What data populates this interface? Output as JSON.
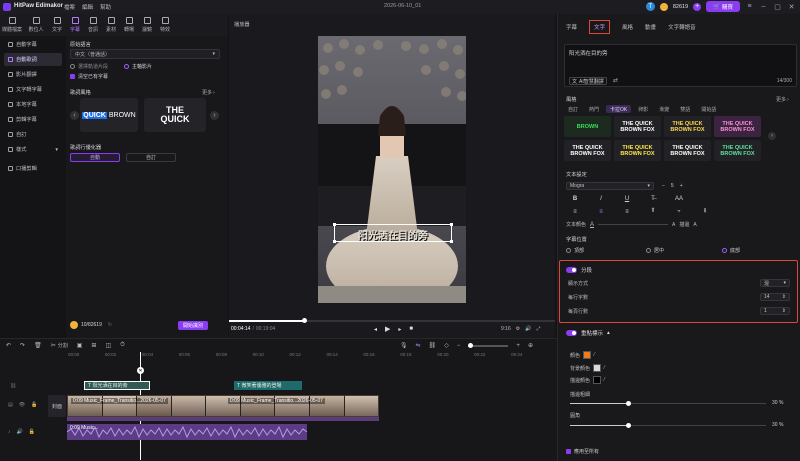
{
  "titlebar": {
    "app_name": "HitPaw Edimakor",
    "menu": [
      "檔案",
      "編輯",
      "幫助"
    ],
    "doc_title": "2026-06-10_01",
    "avatar_letter": "T",
    "credits": "82619",
    "buy_label": "購買"
  },
  "toolbar": [
    {
      "label": "媒體檔案",
      "icon": "media-icon"
    },
    {
      "label": "數位人",
      "icon": "avatar-icon"
    },
    {
      "label": "文字",
      "icon": "text-icon"
    },
    {
      "label": "字幕",
      "icon": "subtitle-icon",
      "active": true
    },
    {
      "label": "音訊",
      "icon": "audio-icon"
    },
    {
      "label": "素材",
      "icon": "stock-icon"
    },
    {
      "label": "轉場",
      "icon": "transition-icon"
    },
    {
      "label": "濾鏡",
      "icon": "filter-icon"
    },
    {
      "label": "特效",
      "icon": "effects-icon"
    }
  ],
  "leftnav": [
    {
      "label": "自動字幕"
    },
    {
      "label": "自動歌詞",
      "active": true
    },
    {
      "label": "影片翻譯"
    },
    {
      "label": "文字轉字幕"
    },
    {
      "label": "本地字幕"
    },
    {
      "label": "剪輯字幕"
    },
    {
      "label": "自訂"
    },
    {
      "label": "樣式"
    },
    {
      "label": "口播剪輯"
    }
  ],
  "subpanel": {
    "lang_label": "原始語言",
    "lang_value": "中文（普通話）",
    "radio1": "選擇軌道片段",
    "radio2": "主軸影片",
    "checkbox": "清空已有字幕",
    "style_label": "歌詞風格",
    "more": "更多",
    "style1_a": "QUICK",
    "style1_b": "BROWN",
    "style2_a": "THE",
    "style2_b": "QUICK",
    "optimizer_label": "歌詞行優化器",
    "seg_auto": "自動",
    "seg_custom": "自訂",
    "cost": "10/82619",
    "start_label": "開始識別"
  },
  "preview": {
    "header": "播放器",
    "caption": "阳光洒在目的旁",
    "time_current": "00:04:14",
    "time_total": "00:19:04",
    "aspect": "9:16",
    "progress": 0.23
  },
  "timeline": {
    "split_label": "分割",
    "ruler": [
      "00:00",
      "00:02",
      "00:04",
      "00:06",
      "00:08",
      "00:10",
      "00:12",
      "00:14",
      "00:16",
      "00:18",
      "00:20",
      "00:22",
      "00:24"
    ],
    "sub_clip1": "阳光洒在目的旁",
    "sub_clip2": "微笑著優雅的登場",
    "video_clip": "0:09 Music_Frame_Transitio...2026-05-07",
    "audio_clip": "0:09 Music...",
    "track_cover": "封面"
  },
  "rightpanel": {
    "tabs": [
      "字幕",
      "文字",
      "風格",
      "動畫",
      "文字轉語音"
    ],
    "active_tab": "文字",
    "text_placeholder": "阳光洒在目的旁",
    "ai_label": "AI智慧翻譯",
    "char_count": "14/300",
    "style_label": "風格",
    "more": "更多",
    "style_tabs": [
      "自訂",
      "熱門",
      "卡拉OK",
      "卵影",
      "漸變",
      "雙語",
      "開始語"
    ],
    "active_style_tab": "卡拉OK",
    "presets": [
      {
        "a": "BROWN",
        "b": "",
        "color": "#38e05a",
        "bg": "#1d2a20"
      },
      {
        "a": "THE QUICK",
        "b": "BROWN FOX",
        "color": "#ffffff",
        "bg": "#222226"
      },
      {
        "a": "THE QUICK",
        "b": "BROWN FOX",
        "color": "#ffd84a",
        "bg": "#222226"
      },
      {
        "a": "THE QUICK",
        "b": "BROWN FOX",
        "color": "#ff8fd9",
        "bg": "#3a2440"
      },
      {
        "a": "THE QUICK",
        "b": "BROWN FOX",
        "color": "#ffffff",
        "bg": "#222226"
      },
      {
        "a": "THE QUICK",
        "b": "BROWN FOX",
        "color": "#ffe84a",
        "bg": "#222226"
      },
      {
        "a": "THE QUICK",
        "b": "BROWN FOX",
        "color": "#ffffff",
        "bg": "#222226"
      },
      {
        "a": "THE QUICK",
        "b": "BROWN FOX",
        "color": "#5fe0a0",
        "bg": "#222226"
      }
    ],
    "text_settings_label": "文本設定",
    "font": "Mogra",
    "font_size": "5",
    "text_color_label": "文本顏色",
    "stroke_label": "描邊",
    "position_label": "字幕位置",
    "pos_top": "頂部",
    "pos_mid": "居中",
    "pos_bottom": "底部",
    "segment_label": "分段",
    "display_mode_label": "顯示方式",
    "display_mode": "混",
    "chars_per_line_label": "每行字數",
    "chars_per_line": "14",
    "lines_label": "每頁行數",
    "lines": "1",
    "highlight_label": "重點標示",
    "color_label": "顏色",
    "bg_color_label": "背景顏色",
    "stroke_color_label": "描邊顏色",
    "stroke_width_label": "描邊粗細",
    "stroke_width": "30 %",
    "corner_label": "圓角",
    "corner": "30 %",
    "apply_all": "應用至所有"
  }
}
